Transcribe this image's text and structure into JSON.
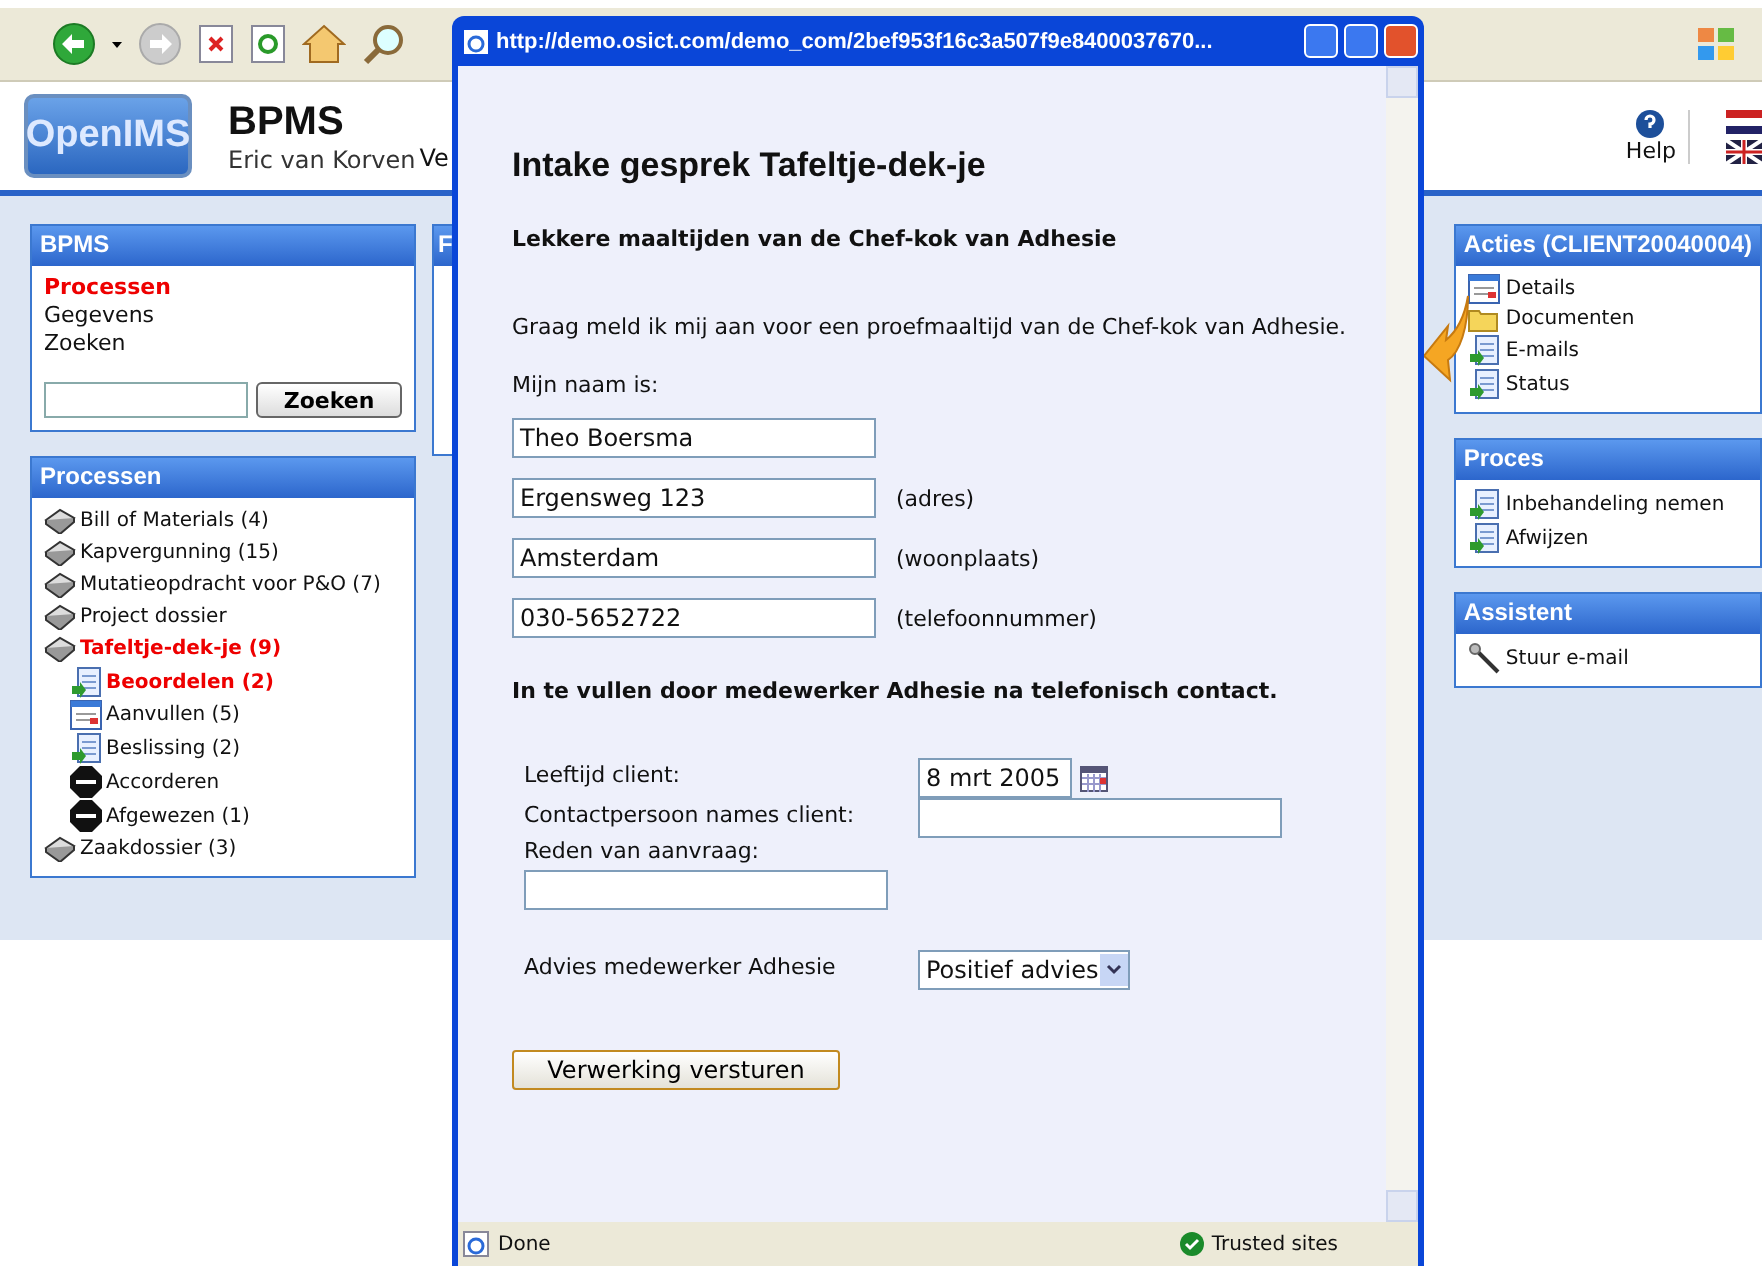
{
  "header": {
    "logo": "OpenIMS",
    "title": "BPMS",
    "user": "Eric van Korven",
    "cut_label": "Ve",
    "help": "Help"
  },
  "left_panels": [
    {
      "kind": "nav",
      "title": "BPMS",
      "items": [
        {
          "label": "Processen",
          "selected": true
        },
        {
          "label": "Gegevens",
          "selected": false
        },
        {
          "label": "Zoeken",
          "selected": false
        }
      ],
      "search_button": "Zoeken"
    },
    {
      "kind": "tree",
      "title": "Processen",
      "items": [
        {
          "label": "Bill of Materials (4)",
          "kind": "book",
          "selected": false
        },
        {
          "label": "Kapvergunning (15)",
          "kind": "book",
          "selected": false
        },
        {
          "label": "Mutatieopdracht voor P&O (7)",
          "kind": "book",
          "selected": false
        },
        {
          "label": "Project dossier",
          "kind": "book",
          "selected": false
        },
        {
          "label": "Tafeltje-dek-je (9)",
          "kind": "book",
          "selected": true,
          "children": [
            {
              "label": "Beoordelen (2)",
              "kind": "task",
              "selected": true
            },
            {
              "label": "Aanvullen (5)",
              "kind": "form",
              "selected": false
            },
            {
              "label": "Beslissing (2)",
              "kind": "task",
              "selected": false
            },
            {
              "label": "Accorderen",
              "kind": "stop",
              "selected": false
            },
            {
              "label": "Afgewezen (1)",
              "kind": "stop",
              "selected": false
            }
          ]
        },
        {
          "label": "Zaakdossier (3)",
          "kind": "book",
          "selected": false
        }
      ]
    }
  ],
  "middle_panel": {
    "title": "F"
  },
  "right_panels": [
    {
      "title": "Acties (CLIENT20040004)",
      "items": [
        {
          "label": "Details",
          "kind": "form"
        },
        {
          "label": "Documenten",
          "kind": "folder"
        },
        {
          "label": "E-mails",
          "kind": "task"
        },
        {
          "label": "Status",
          "kind": "task"
        }
      ]
    },
    {
      "title": "Proces",
      "items": [
        {
          "label": "Inbehandeling nemen",
          "kind": "task"
        },
        {
          "label": "Afwijzen",
          "kind": "task"
        }
      ]
    },
    {
      "title": "Assistent",
      "items": [
        {
          "label": "Stuur e-mail",
          "kind": "wand"
        }
      ]
    }
  ],
  "popup": {
    "title": "http://demo.osict.com/demo_com/2bef953f16c3a507f9e8400037670...",
    "heading": "Intake gesprek Tafeltje-dek-je",
    "subheading": "Lekkere maaltijden van de Chef-kok van Adhesie",
    "intro": "Graag meld ik mij aan voor een proefmaaltijd van de Chef-kok van Adhesie.",
    "name_label": "Mijn naam is:",
    "fields": [
      {
        "value": "Theo Boersma"
      },
      {
        "value": "Ergensweg 123",
        "note": "(adres)"
      },
      {
        "value": "Amsterdam",
        "note": "(woonplaats)"
      },
      {
        "value": "030-5652722",
        "note": "(telefoonnummer)"
      }
    ],
    "section": "In te vullen door medewerker Adhesie na telefonisch contact.",
    "rows": [
      {
        "kind": "date",
        "label": "Leeftijd client:",
        "value": "8 mrt 2005"
      },
      {
        "kind": "text",
        "label": "Contactpersoon names client:"
      },
      {
        "kind": "stacked",
        "label": "Reden van aanvraag:"
      },
      {
        "kind": "select",
        "label": "Advies medewerker Adhesie",
        "value": "Positief advies"
      }
    ],
    "submit": "Verwerking versturen",
    "status": "Done",
    "zone": "Trusted sites"
  }
}
